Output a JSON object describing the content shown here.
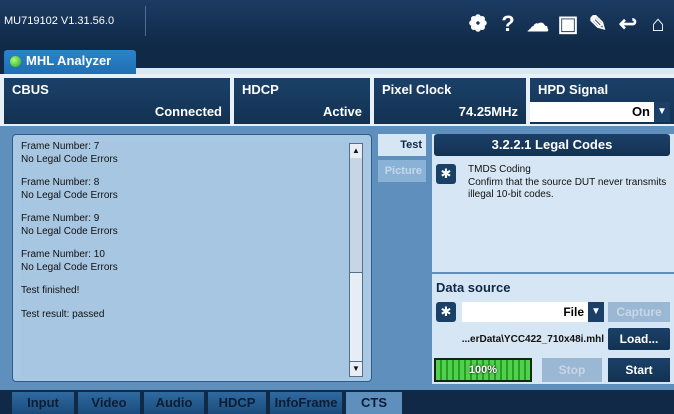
{
  "app": {
    "version": "MU719102 V1.31.56.0"
  },
  "toolbar": {
    "icons": [
      "palette-icon",
      "help-icon",
      "cloud-icon",
      "save-icon",
      "wrench-icon",
      "back-icon",
      "home-icon"
    ],
    "glyphs": [
      "❁",
      "?",
      "☁",
      "▣",
      "✎",
      "↩",
      "⌂"
    ]
  },
  "tab": {
    "label": "MHL Analyzer"
  },
  "status": {
    "cbus": {
      "label": "CBUS",
      "value": "Connected"
    },
    "hdcp": {
      "label": "HDCP",
      "value": "Active"
    },
    "pixel_clock": {
      "label": "Pixel Clock",
      "value": "74.25MHz"
    },
    "hpd_signal": {
      "label": "HPD Signal",
      "value": "On"
    }
  },
  "log": {
    "lines": [
      "Frame Number: 7",
      "No Legal Code Errors",
      "",
      "Frame Number: 8",
      "No Legal Code Errors",
      "",
      "Frame Number: 9",
      "No Legal Code Errors",
      "",
      "Frame Number: 10",
      "No Legal Code Errors",
      "",
      "Test finished!",
      "",
      "Test result: passed"
    ]
  },
  "side_tabs": {
    "test": "Test",
    "picture": "Picture"
  },
  "test": {
    "title": "3.2.2.1 Legal Codes",
    "name": "TMDS Coding",
    "description": "Confirm that the source DUT never transmits illegal 10-bit codes."
  },
  "datasource": {
    "label": "Data source",
    "selected": "File",
    "capture_label": "Capture",
    "file_path": "...erData\\YCC422_710x48i.mhl",
    "load_label": "Load...",
    "progress_fraction": 1.0,
    "progress_text": "100%",
    "stop_label": "Stop",
    "start_label": "Start"
  },
  "bottom_tabs": [
    "Input",
    "Video",
    "Audio",
    "HDCP",
    "InfoFrame",
    "CTS"
  ],
  "bottom_tabs_active": "CTS"
}
